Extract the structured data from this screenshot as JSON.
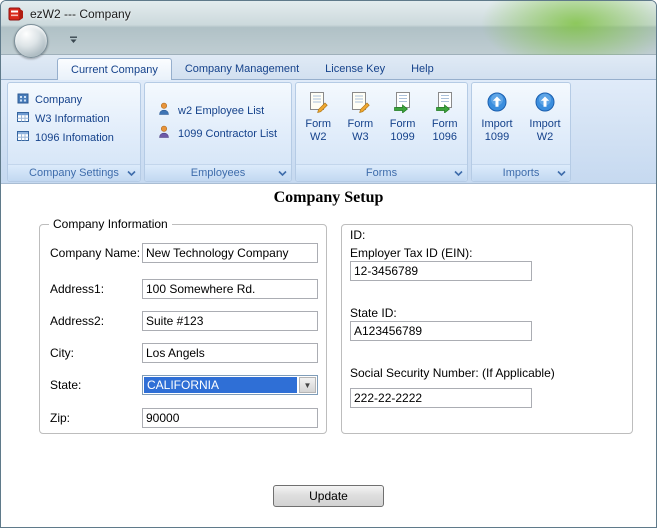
{
  "window": {
    "title": "ezW2 --- Company"
  },
  "colors": {
    "selection_blue": "#2f6fd6",
    "ribbon_text": "#15428b",
    "caption_text": "#3e6cab"
  },
  "ribbon": {
    "tabs": [
      {
        "label": "Current Company",
        "active": true
      },
      {
        "label": "Company Management",
        "active": false
      },
      {
        "label": "License Key",
        "active": false
      },
      {
        "label": "Help",
        "active": false
      }
    ],
    "groups": {
      "settings": {
        "title": "Company Settings",
        "items": [
          {
            "label": "Company"
          },
          {
            "label": "W3 Information"
          },
          {
            "label": "1096 Infomation"
          }
        ]
      },
      "employees": {
        "title": "Employees",
        "items": [
          {
            "label": "w2 Employee List"
          },
          {
            "label": "1099 Contractor List"
          }
        ]
      },
      "forms": {
        "title": "Forms",
        "items": [
          {
            "line1": "Form",
            "line2": "W2"
          },
          {
            "line1": "Form",
            "line2": "W3"
          },
          {
            "line1": "Form",
            "line2": "1099"
          },
          {
            "line1": "Form",
            "line2": "1096"
          }
        ]
      },
      "imports": {
        "title": "Imports",
        "items": [
          {
            "line1": "Import",
            "line2": "1099"
          },
          {
            "line1": "Import",
            "line2": "W2"
          }
        ]
      }
    }
  },
  "main": {
    "heading": "Company Setup",
    "company_info": {
      "legend": "Company Information",
      "fields": {
        "company_name": {
          "label": "Company Name:",
          "value": "New Technology Company"
        },
        "address1": {
          "label": "Address1:",
          "value": "100 Somewhere Rd."
        },
        "address2": {
          "label": "Address2:",
          "value": "Suite #123"
        },
        "city": {
          "label": "City:",
          "value": "Los Angels"
        },
        "state": {
          "label": "State:",
          "value": "CALIFORNIA"
        },
        "zip": {
          "label": "Zip:",
          "value": "90000"
        }
      }
    },
    "ids": {
      "heading": "ID:",
      "ein": {
        "label": "Employer Tax ID (EIN):",
        "value": "12-3456789"
      },
      "state_id": {
        "label": "State ID:",
        "value": "A123456789"
      },
      "ssn": {
        "label": "Social Security Number: (If Applicable)",
        "value": "222-22-2222"
      }
    },
    "update_button": "Update"
  }
}
